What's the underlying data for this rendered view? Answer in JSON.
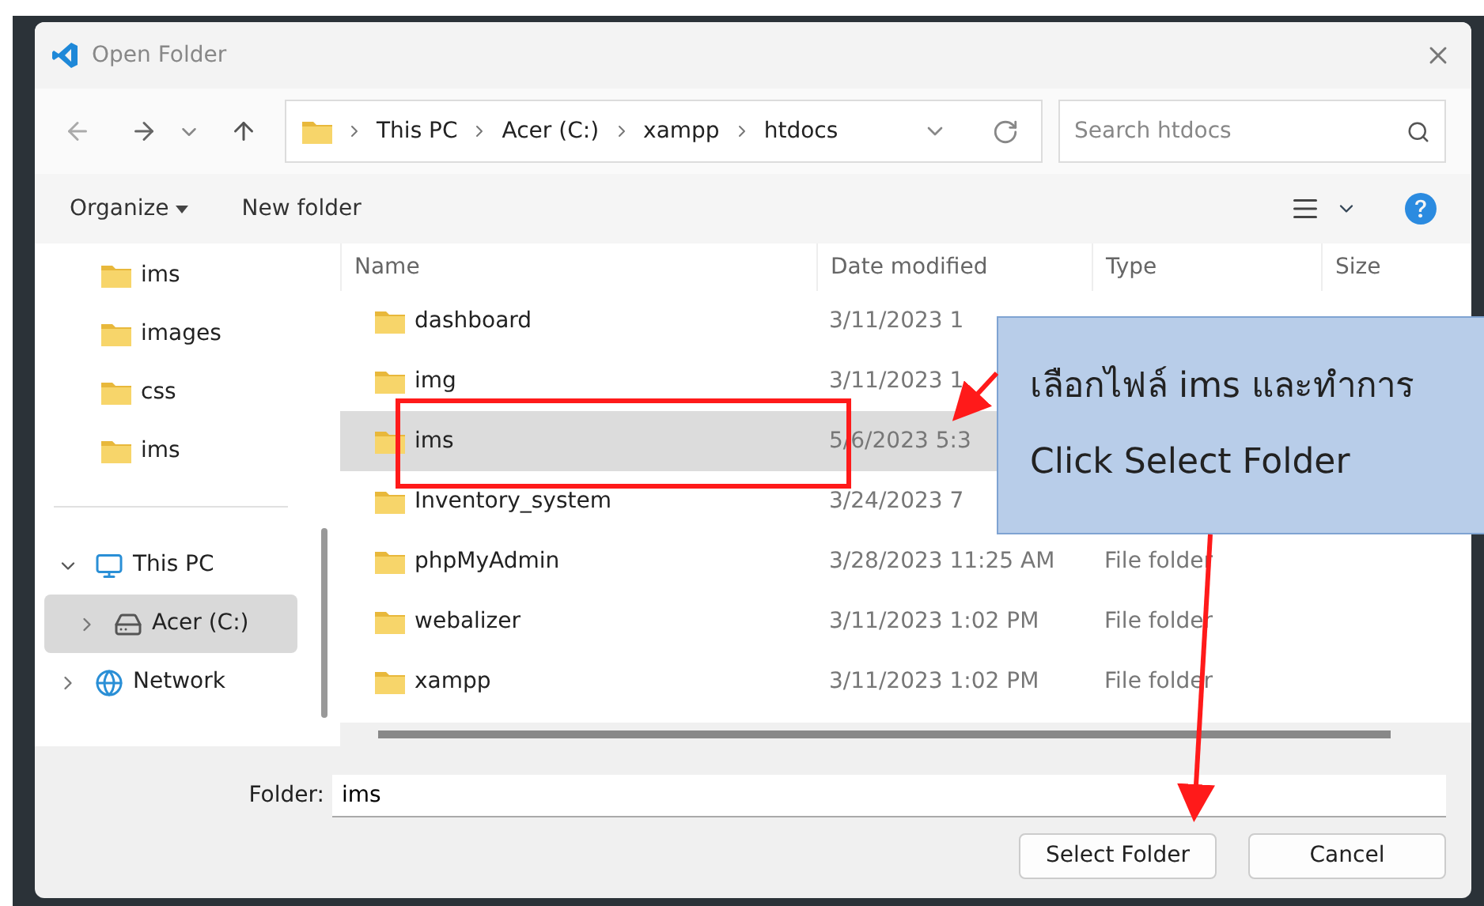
{
  "window": {
    "title": "Open Folder"
  },
  "breadcrumb": [
    "This PC",
    "Acer (C:)",
    "xampp",
    "htdocs"
  ],
  "search": {
    "placeholder": "Search htdocs"
  },
  "toolbar": {
    "organize": "Organize",
    "new_folder": "New folder"
  },
  "sidebar": {
    "quick_access": [
      {
        "label": "ims"
      },
      {
        "label": "images"
      },
      {
        "label": "css"
      },
      {
        "label": "ims"
      }
    ],
    "tree": [
      {
        "label": "This PC",
        "kind": "pc",
        "expanded": true,
        "selected": false,
        "children": [
          {
            "label": "Acer (C:)",
            "kind": "drive",
            "expanded": false,
            "selected": true
          }
        ]
      },
      {
        "label": "Network",
        "kind": "network",
        "expanded": false,
        "selected": false
      }
    ]
  },
  "table": {
    "columns": [
      "Name",
      "Date modified",
      "Type",
      "Size"
    ],
    "rows": [
      {
        "name": "dashboard",
        "date": "3/11/2023 1",
        "selected": false
      },
      {
        "name": "img",
        "date": "3/11/2023 1",
        "selected": false
      },
      {
        "name": "ims",
        "date": "5/6/2023 5:3",
        "selected": true
      },
      {
        "name": "Inventory_system",
        "date": "3/24/2023 7",
        "selected": false
      },
      {
        "name": "phpMyAdmin",
        "date": "3/28/2023 11:25 AM",
        "type": "File folder",
        "selected": false
      },
      {
        "name": "webalizer",
        "date": "3/11/2023 1:02 PM",
        "type": "File folder",
        "selected": false
      },
      {
        "name": "xampp",
        "date": "3/11/2023 1:02 PM",
        "type": "File folder",
        "selected": false
      }
    ]
  },
  "footer": {
    "folder_label": "Folder:",
    "folder_value": "ims",
    "buttons": [
      "Select Folder",
      "Cancel"
    ]
  },
  "annotation": {
    "lines": [
      "เลือกไฟล์ ims และทำการ",
      "Click Select Folder"
    ]
  }
}
